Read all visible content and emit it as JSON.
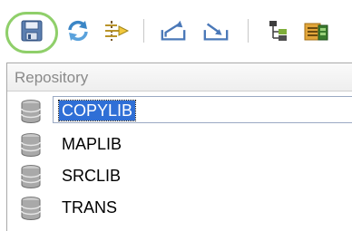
{
  "toolbar": {
    "buttons": [
      {
        "icon": "save-icon",
        "highlighted": true
      },
      {
        "icon": "refresh-icon"
      },
      {
        "icon": "compare-icon"
      },
      {
        "icon": "export-icon"
      },
      {
        "icon": "import-icon"
      },
      {
        "icon": "tree-icon"
      },
      {
        "icon": "properties-icon"
      }
    ],
    "highlight_color": "#8fcf6a"
  },
  "repository": {
    "header": "Repository",
    "items": [
      {
        "label": "COPYLIB",
        "selected": true
      },
      {
        "label": "MAPLIB",
        "selected": false
      },
      {
        "label": "SRCLIB",
        "selected": false
      },
      {
        "label": "TRANS",
        "selected": false
      }
    ],
    "selection_color": "#2f6fd6"
  }
}
